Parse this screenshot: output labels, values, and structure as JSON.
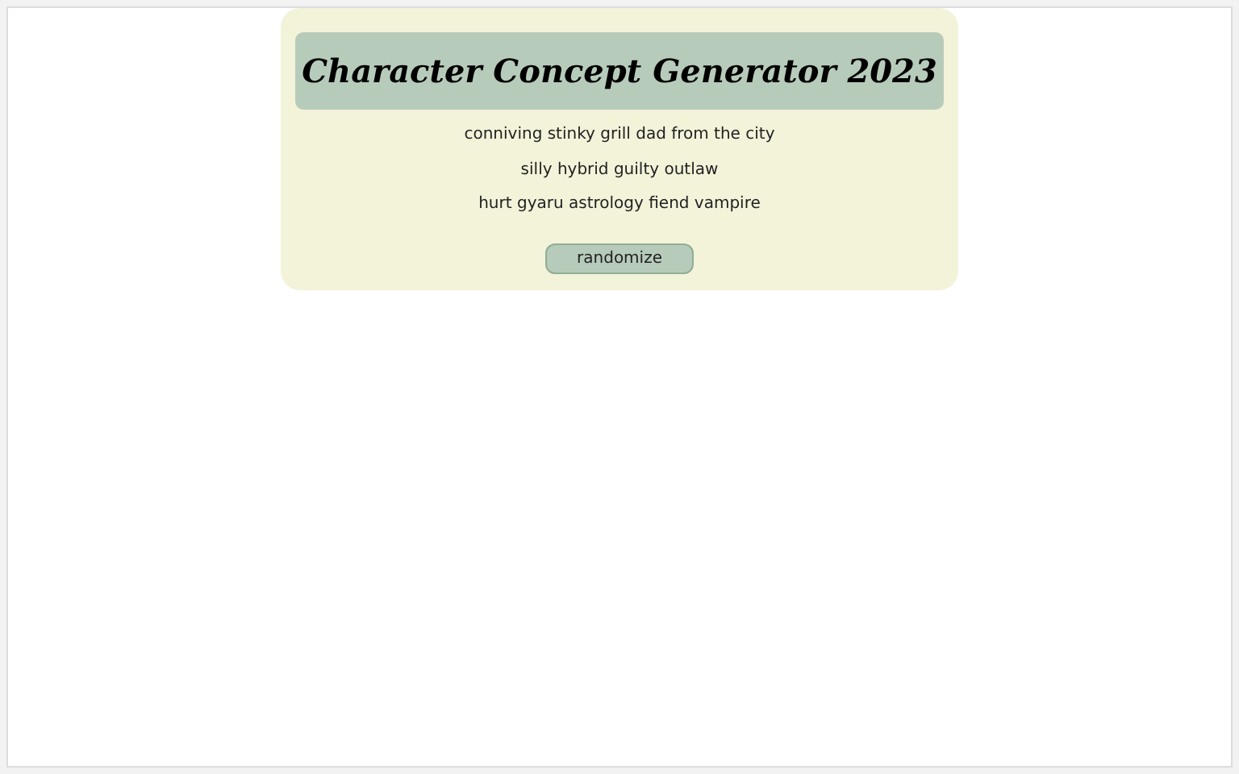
{
  "title": "Character Concept Generator 2023",
  "concepts": [
    "conniving stinky grill dad from the city",
    "silly hybrid guilty outlaw",
    "hurt gyaru astrology fiend vampire"
  ],
  "button": "randomize"
}
